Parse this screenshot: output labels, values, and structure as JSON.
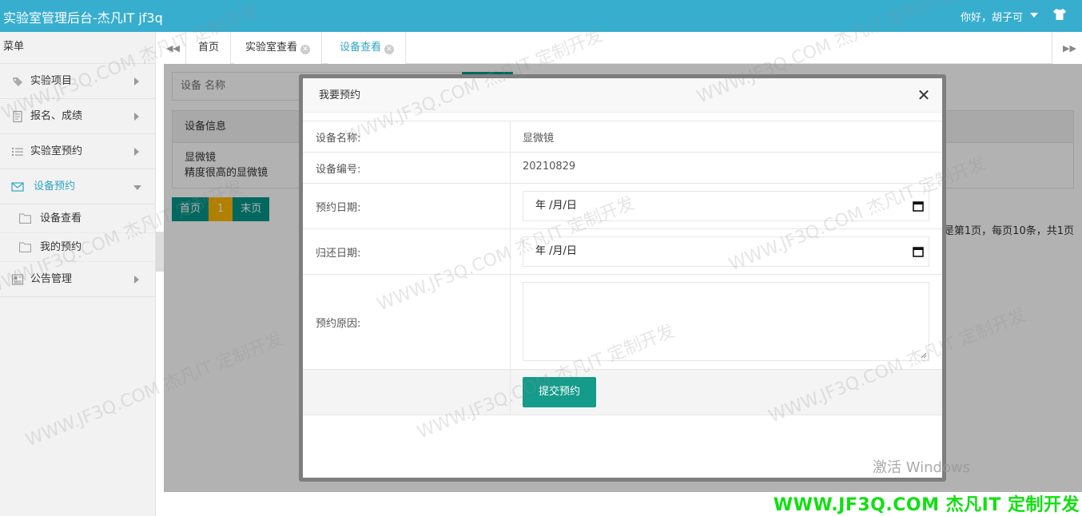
{
  "header": {
    "app_title": "实验室管理后台-杰凡IT jf3q",
    "greeting": "你好，胡子可"
  },
  "sidebar": {
    "menu_title": "菜单",
    "items": [
      {
        "label": "实验项目",
        "icon": "tag-icon"
      },
      {
        "label": "报名、成绩",
        "icon": "document-icon"
      },
      {
        "label": "实验室预约",
        "icon": "list-icon"
      },
      {
        "label": "设备预约",
        "icon": "envelope-icon",
        "active": true,
        "children": [
          {
            "label": "设备查看",
            "icon": "folder-icon"
          },
          {
            "label": "我的预约",
            "icon": "folder-icon"
          }
        ]
      },
      {
        "label": "公告管理",
        "icon": "newspaper-icon"
      }
    ]
  },
  "tabs": [
    {
      "label": "首页"
    },
    {
      "label": "实验室查看"
    },
    {
      "label": "设备查看",
      "active": true
    }
  ],
  "content": {
    "search_placeholder": "设备 名称",
    "table_header": "设备信息",
    "row_name": "显微镜",
    "row_desc": "精度很高的显微镜",
    "pager": {
      "first": "首页",
      "current": "1",
      "last": "末页"
    },
    "pager_info": "是第1页，每页10条，共1页"
  },
  "modal": {
    "title": "我要预约",
    "fields": {
      "name_label": "设备名称:",
      "name_value": "显微镜",
      "code_label": "设备编号:",
      "code_value": "20210829",
      "date_label": "预约日期:",
      "date_placeholder": "年 /月/日",
      "return_label": "归还日期:",
      "return_placeholder": "年 /月/日",
      "reason_label": "预约原因:"
    },
    "submit_label": "提交预约"
  },
  "overlay": {
    "windows_activation": "激活 Windows",
    "brand_banner": "WWW.JF3Q.COM 杰凡IT  定制开发",
    "watermark_text": "WWW.JF3Q.COM 杰凡IT  定制开发"
  },
  "colors": {
    "header_bg": "#38aecf",
    "accent": "#2fa4c4",
    "primary_button": "#159b8a",
    "pager_current": "#ffb800",
    "banner_text": "#11e011"
  }
}
